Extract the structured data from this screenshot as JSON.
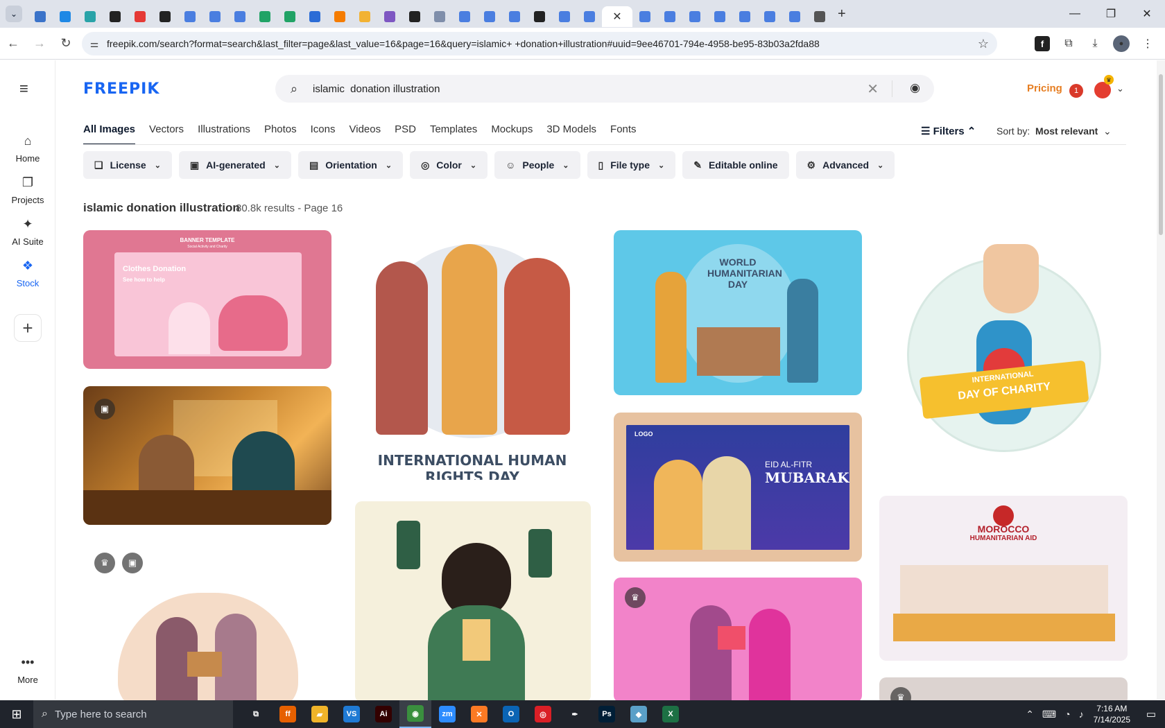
{
  "browser": {
    "url": "freepik.com/search?format=search&last_filter=page&last_value=16&page=16&query=islamic+ +donation+illustration#uuid=9ee46701-794e-4958-be95-83b03a2fda88",
    "tab_favicon_colors": [
      "#3b73c9",
      "#1e88e5",
      "#29a3a8",
      "#222",
      "#e53935",
      "#222",
      "#4a7ee0",
      "#4a7ee0",
      "#4a7ee0",
      "#21a366",
      "#21a366",
      "#2b6cd6",
      "#f57c00",
      "#f2b233",
      "#7e57c2",
      "#222",
      "#7f8eaa",
      "#4a7ee0",
      "#4a7ee0",
      "#4a7ee0",
      "#222",
      "#4a7ee0",
      "#4a7ee0"
    ],
    "tab_favicon_colors_after": [
      "#4a7ee0",
      "#4a7ee0",
      "#4a7ee0",
      "#4a7ee0",
      "#4a7ee0",
      "#4a7ee0",
      "#4a7ee0",
      "#555"
    ],
    "active_tab_close": "✕",
    "new_tab": "+"
  },
  "freepik": {
    "logo": "FREEPIK",
    "search_value": "islamic  donation illustration",
    "pricing": "Pricing",
    "notification_count": "1",
    "rail": [
      {
        "label": "Home",
        "icon": "home-icon",
        "glyph": "⌂"
      },
      {
        "label": "Projects",
        "icon": "projects-icon",
        "glyph": "❐"
      },
      {
        "label": "AI Suite",
        "icon": "sparkle-icon",
        "glyph": "✦"
      },
      {
        "label": "Stock",
        "icon": "stock-icon",
        "glyph": "❖"
      }
    ],
    "rail_more": "More",
    "category_tabs": [
      "All Images",
      "Vectors",
      "Illustrations",
      "Photos",
      "Icons",
      "Videos",
      "PSD",
      "Templates",
      "Mockups",
      "3D Models",
      "Fonts"
    ],
    "filters_label": "Filters",
    "sort_label": "Sort by:",
    "sort_value": "Most relevant",
    "filter_pills": [
      {
        "label": "License",
        "glyph": "❏"
      },
      {
        "label": "AI-generated",
        "glyph": "▣"
      },
      {
        "label": "Orientation",
        "glyph": "▤"
      },
      {
        "label": "Color",
        "glyph": "◎"
      },
      {
        "label": "People",
        "glyph": "☺"
      },
      {
        "label": "File type",
        "glyph": "▯"
      },
      {
        "label": "Editable online",
        "glyph": "✎"
      },
      {
        "label": "Advanced",
        "glyph": "⚙"
      }
    ],
    "results_title": "islamic donation illustration",
    "results_count": "80.8k results - Page 16",
    "cards": {
      "clothes_banner_title": "BANNER TEMPLATE",
      "clothes_banner_sub": "Social Activity and Charity",
      "clothes_title": "Clothes Donation",
      "clothes_sub": "See how to help",
      "human_rights": "INTERNATIONAL HUMAN RIGHTS DAY",
      "world_day": "WORLD HUMANITARIAN DAY",
      "charity_intl": "INTERNATIONAL",
      "charity_day": "DAY OF CHARITY",
      "eid_logo": "LOGO",
      "eid_small": "EID AL-FITR",
      "eid_big": "MUBARAK",
      "morocco": "MOROCCO",
      "morocco_sub": "HUMANITARIAN AID"
    }
  },
  "taskbar": {
    "search_placeholder": "Type here to search",
    "time": "7:16 AM",
    "date": "7/14/2025",
    "apps": [
      {
        "name": "task-view",
        "label": "⧉",
        "color": "#20242c"
      },
      {
        "name": "firefox",
        "label": "ff",
        "color": "#e66000"
      },
      {
        "name": "file-explorer",
        "label": "▰",
        "color": "#f0b429"
      },
      {
        "name": "vscode",
        "label": "VS",
        "color": "#1f7ad4"
      },
      {
        "name": "illustrator",
        "label": "Ai",
        "color": "#330000"
      },
      {
        "name": "chrome",
        "label": "◉",
        "color": "#3a8f3e"
      },
      {
        "name": "zoom",
        "label": "zm",
        "color": "#2d8cff"
      },
      {
        "name": "xampp",
        "label": "✕",
        "color": "#fb7a24"
      },
      {
        "name": "outlook",
        "label": "O",
        "color": "#0a64b4"
      },
      {
        "name": "creative-cloud",
        "label": "◎",
        "color": "#da1f26"
      },
      {
        "name": "pen-tool",
        "label": "✒",
        "color": "#20242c"
      },
      {
        "name": "photoshop",
        "label": "Ps",
        "color": "#001e36"
      },
      {
        "name": "app-diamond",
        "label": "◆",
        "color": "#5aa0c8"
      },
      {
        "name": "excel",
        "label": "X",
        "color": "#1d7044"
      }
    ]
  }
}
